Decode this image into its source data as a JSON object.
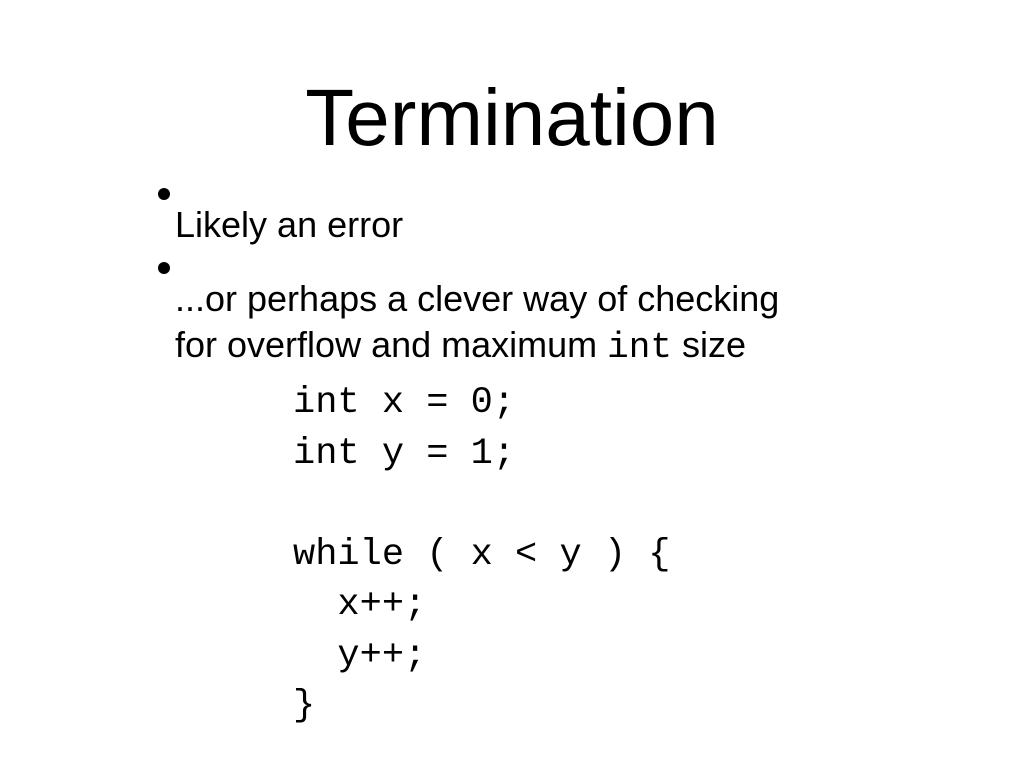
{
  "slide": {
    "title": "Termination",
    "bullets": [
      {
        "text": "Likely an error"
      },
      {
        "line1": "...or perhaps a clever way of checking",
        "line2_pre": "for overflow and maximum ",
        "line2_code": "int",
        "line2_post": " size"
      }
    ],
    "code": "int x = 0;\nint y = 1;\n\nwhile ( x < y ) {\n  x++;\n  y++;\n}"
  }
}
